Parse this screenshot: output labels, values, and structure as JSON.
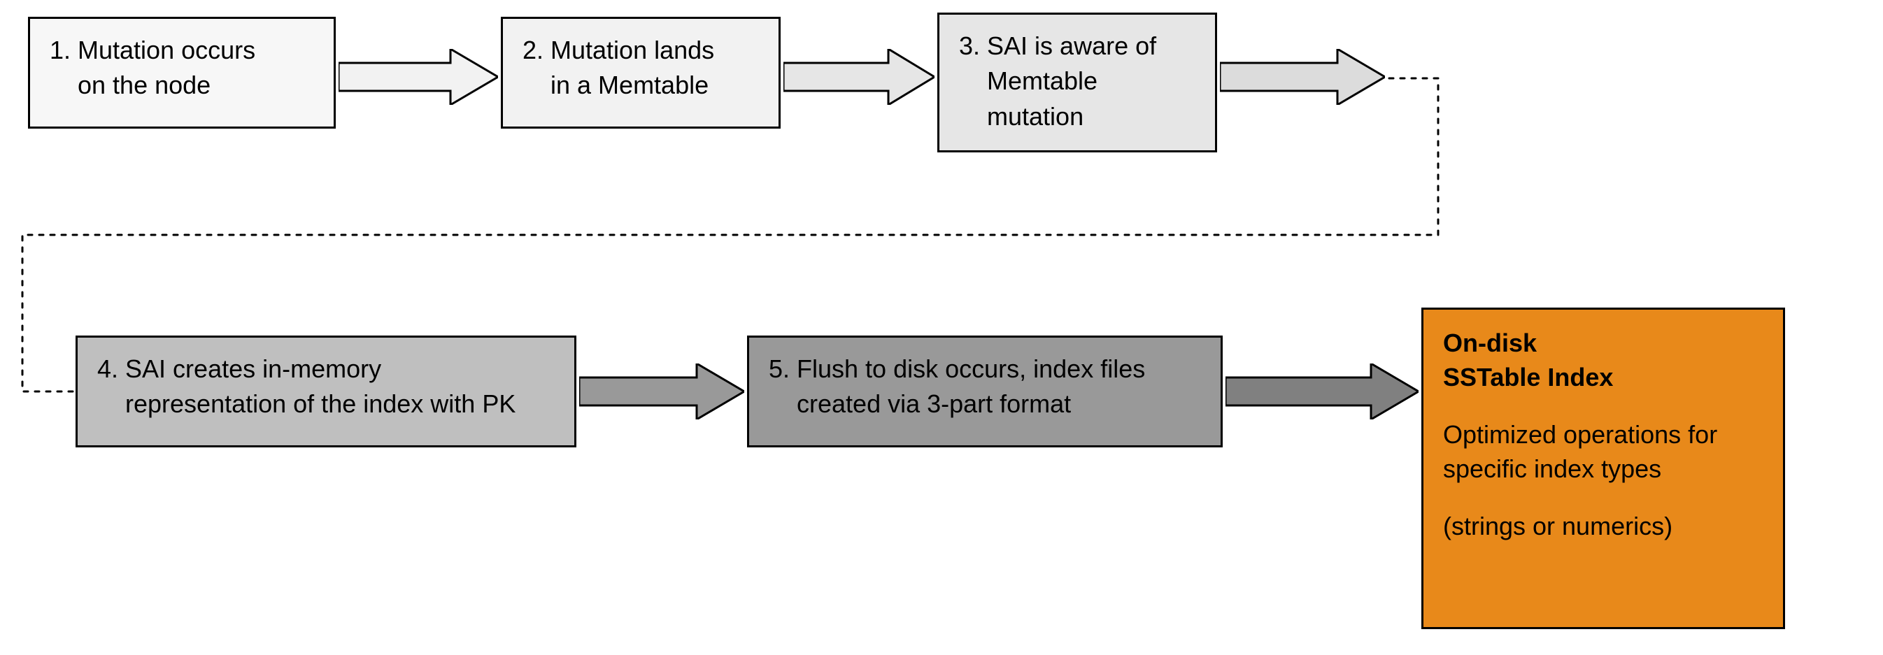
{
  "steps": {
    "s1": "1. Mutation occurs\n    on the node",
    "s2": "2. Mutation lands\n    in a Memtable",
    "s3": "3. SAI is aware of\n    Memtable\n    mutation",
    "s4": "4. SAI creates in-memory\n    representation of the index with PK",
    "s5": "5. Flush to disk occurs, index files\n    created via 3-part format"
  },
  "final": {
    "title": "On-disk\nSSTable Index",
    "body1": "Optimized operations for specific index types",
    "body2": "(strings or numerics)"
  },
  "colors": {
    "s1": "#f7f7f7",
    "s2": "#f2f2f2",
    "s3": "#e6e6e6",
    "s4": "#bfbfbf",
    "s5": "#999999",
    "final": "#e8891a"
  }
}
